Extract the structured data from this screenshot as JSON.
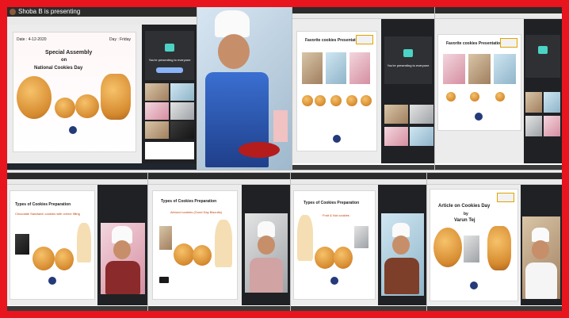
{
  "presenter": "Shoba B is presenting",
  "slides": {
    "special_assembly": {
      "date_label": "Date : 4-12-2020",
      "day_label": "Day : Friday",
      "title_line1": "Special  Assembly",
      "title_line2": "on",
      "title_line3": "National Cookies Day"
    },
    "favorite_cookies": {
      "title": "Favorite cookies Presentation"
    },
    "types_1": {
      "title": "Types of Cookies Preparation",
      "subtitle": "Chocolate Sandwich cookies with creme filling"
    },
    "types_2": {
      "title": "Types of Cookies Preparation",
      "subtitle": "Almond cookies (Good Day Biscuits)"
    },
    "types_3": {
      "title": "Types of Cookies Preparation",
      "subtitle": "Fruit & Nut cookies"
    },
    "article": {
      "title_line1": "Article  on Cookies Day",
      "title_line2": "by",
      "title_line3": "Varun Tej"
    }
  },
  "meeting": {
    "presenting_msg": "You're presenting to everyone",
    "stop_label": "Stop presenting"
  },
  "colors": {
    "frame": "#e8141e",
    "accent": "#d2232a",
    "meet_dark": "#1f1f1f"
  }
}
